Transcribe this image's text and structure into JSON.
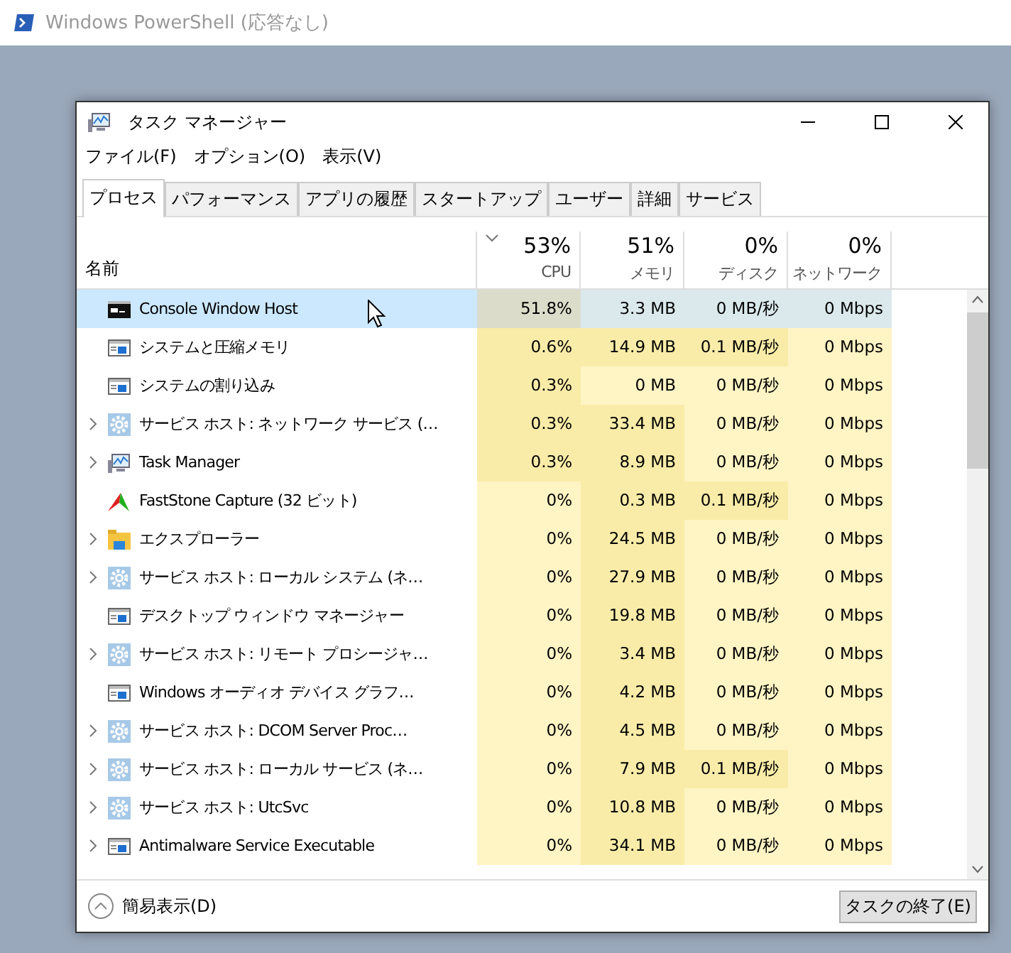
{
  "app_window": {
    "title": "Windows PowerShell (応答なし)"
  },
  "window": {
    "title": "タスク マネージャー"
  },
  "menu": [
    "ファイル(F)",
    "オプション(O)",
    "表示(V)"
  ],
  "tabs": [
    {
      "label": "プロセス",
      "selected": true
    },
    {
      "label": "パフォーマンス",
      "selected": false
    },
    {
      "label": "アプリの履歴",
      "selected": false
    },
    {
      "label": "スタートアップ",
      "selected": false
    },
    {
      "label": "ユーザー",
      "selected": false
    },
    {
      "label": "詳細",
      "selected": false
    },
    {
      "label": "サービス",
      "selected": false
    }
  ],
  "table": {
    "name_column": "名前",
    "columns": [
      {
        "percent": "53%",
        "label": "CPU",
        "sorted": true
      },
      {
        "percent": "51%",
        "label": "メモリ",
        "sorted": false
      },
      {
        "percent": "0%",
        "label": "ディスク",
        "sorted": false
      },
      {
        "percent": "0%",
        "label": "ネットワーク",
        "sorted": false
      }
    ],
    "rows": [
      {
        "name": "Console Window Host",
        "kind": "console",
        "expandable": false,
        "selected": true,
        "cells": [
          {
            "text": "51.8%",
            "color": "#dcdccb"
          },
          {
            "text": "3.3 MB",
            "color": "#dbe9ed"
          },
          {
            "text": "0 MB/秒",
            "color": "#dbe9ed"
          },
          {
            "text": "0 Mbps",
            "color": "#dbe9ed"
          }
        ]
      },
      {
        "name": "システムと圧縮メモリ",
        "kind": "window",
        "expandable": false,
        "selected": false,
        "cells": [
          {
            "text": "0.6%",
            "color": "#f9eca8"
          },
          {
            "text": "14.9 MB",
            "color": "#f9eca8"
          },
          {
            "text": "0.1 MB/秒",
            "color": "#f9eca8"
          },
          {
            "text": "0 Mbps",
            "color": "#fff4c4"
          }
        ]
      },
      {
        "name": "システムの割り込み",
        "kind": "window",
        "expandable": false,
        "selected": false,
        "cells": [
          {
            "text": "0.3%",
            "color": "#f9eca8"
          },
          {
            "text": "0 MB",
            "color": "#fff4c4"
          },
          {
            "text": "0 MB/秒",
            "color": "#fff4c4"
          },
          {
            "text": "0 Mbps",
            "color": "#fff4c4"
          }
        ]
      },
      {
        "name": "サービス ホスト: ネットワーク サービス (…",
        "kind": "gear",
        "expandable": true,
        "selected": false,
        "cells": [
          {
            "text": "0.3%",
            "color": "#f9eca8"
          },
          {
            "text": "33.4 MB",
            "color": "#f9eca8"
          },
          {
            "text": "0 MB/秒",
            "color": "#fff4c4"
          },
          {
            "text": "0 Mbps",
            "color": "#fff4c4"
          }
        ]
      },
      {
        "name": "Task Manager",
        "kind": "monitor",
        "expandable": true,
        "selected": false,
        "cells": [
          {
            "text": "0.3%",
            "color": "#f9eca8"
          },
          {
            "text": "8.9 MB",
            "color": "#f9eca8"
          },
          {
            "text": "0 MB/秒",
            "color": "#fff4c4"
          },
          {
            "text": "0 Mbps",
            "color": "#fff4c4"
          }
        ]
      },
      {
        "name": "FastStone Capture (32 ビット)",
        "kind": "capture",
        "expandable": false,
        "selected": false,
        "cells": [
          {
            "text": "0%",
            "color": "#fff4c4"
          },
          {
            "text": "0.3 MB",
            "color": "#f9eca8"
          },
          {
            "text": "0.1 MB/秒",
            "color": "#f9eca8"
          },
          {
            "text": "0 Mbps",
            "color": "#fff4c4"
          }
        ]
      },
      {
        "name": "エクスプローラー",
        "kind": "folder",
        "expandable": true,
        "selected": false,
        "cells": [
          {
            "text": "0%",
            "color": "#fff4c4"
          },
          {
            "text": "24.5 MB",
            "color": "#f9eca8"
          },
          {
            "text": "0 MB/秒",
            "color": "#fff4c4"
          },
          {
            "text": "0 Mbps",
            "color": "#fff4c4"
          }
        ]
      },
      {
        "name": "サービス ホスト: ローカル システム (ネ…",
        "kind": "gear",
        "expandable": true,
        "selected": false,
        "cells": [
          {
            "text": "0%",
            "color": "#fff4c4"
          },
          {
            "text": "27.9 MB",
            "color": "#f9eca8"
          },
          {
            "text": "0 MB/秒",
            "color": "#fff4c4"
          },
          {
            "text": "0 Mbps",
            "color": "#fff4c4"
          }
        ]
      },
      {
        "name": "デスクトップ ウィンドウ マネージャー",
        "kind": "window",
        "expandable": false,
        "selected": false,
        "cells": [
          {
            "text": "0%",
            "color": "#fff4c4"
          },
          {
            "text": "19.8 MB",
            "color": "#f9eca8"
          },
          {
            "text": "0 MB/秒",
            "color": "#fff4c4"
          },
          {
            "text": "0 Mbps",
            "color": "#fff4c4"
          }
        ]
      },
      {
        "name": "サービス ホスト: リモート プロシージャ…",
        "kind": "gear",
        "expandable": true,
        "selected": false,
        "cells": [
          {
            "text": "0%",
            "color": "#fff4c4"
          },
          {
            "text": "3.4 MB",
            "color": "#f9eca8"
          },
          {
            "text": "0 MB/秒",
            "color": "#fff4c4"
          },
          {
            "text": "0 Mbps",
            "color": "#fff4c4"
          }
        ]
      },
      {
        "name": "Windows オーディオ デバイス グラフ…",
        "kind": "window",
        "expandable": false,
        "selected": false,
        "cells": [
          {
            "text": "0%",
            "color": "#fff4c4"
          },
          {
            "text": "4.2 MB",
            "color": "#f9eca8"
          },
          {
            "text": "0 MB/秒",
            "color": "#fff4c4"
          },
          {
            "text": "0 Mbps",
            "color": "#fff4c4"
          }
        ]
      },
      {
        "name": "サービス ホスト: DCOM Server Proc…",
        "kind": "gear",
        "expandable": true,
        "selected": false,
        "cells": [
          {
            "text": "0%",
            "color": "#fff4c4"
          },
          {
            "text": "4.5 MB",
            "color": "#f9eca8"
          },
          {
            "text": "0 MB/秒",
            "color": "#fff4c4"
          },
          {
            "text": "0 Mbps",
            "color": "#fff4c4"
          }
        ]
      },
      {
        "name": "サービス ホスト: ローカル サービス (ネ…",
        "kind": "gear",
        "expandable": true,
        "selected": false,
        "cells": [
          {
            "text": "0%",
            "color": "#fff4c4"
          },
          {
            "text": "7.9 MB",
            "color": "#f9eca8"
          },
          {
            "text": "0.1 MB/秒",
            "color": "#f9eca8"
          },
          {
            "text": "0 Mbps",
            "color": "#fff4c4"
          }
        ]
      },
      {
        "name": "サービス ホスト: UtcSvc",
        "kind": "gear",
        "expandable": true,
        "selected": false,
        "cells": [
          {
            "text": "0%",
            "color": "#fff4c4"
          },
          {
            "text": "10.8 MB",
            "color": "#f9eca8"
          },
          {
            "text": "0 MB/秒",
            "color": "#fff4c4"
          },
          {
            "text": "0 Mbps",
            "color": "#fff4c4"
          }
        ]
      },
      {
        "name": "Antimalware Service Executable",
        "kind": "window",
        "expandable": true,
        "selected": false,
        "cells": [
          {
            "text": "0%",
            "color": "#fff4c4"
          },
          {
            "text": "34.1 MB",
            "color": "#f9eca8"
          },
          {
            "text": "0 MB/秒",
            "color": "#fff4c4"
          },
          {
            "text": "0 Mbps",
            "color": "#fff4c4"
          }
        ]
      }
    ]
  },
  "footer": {
    "toggle": "簡易表示(D)",
    "end_task": "タスクの終了(E)"
  }
}
